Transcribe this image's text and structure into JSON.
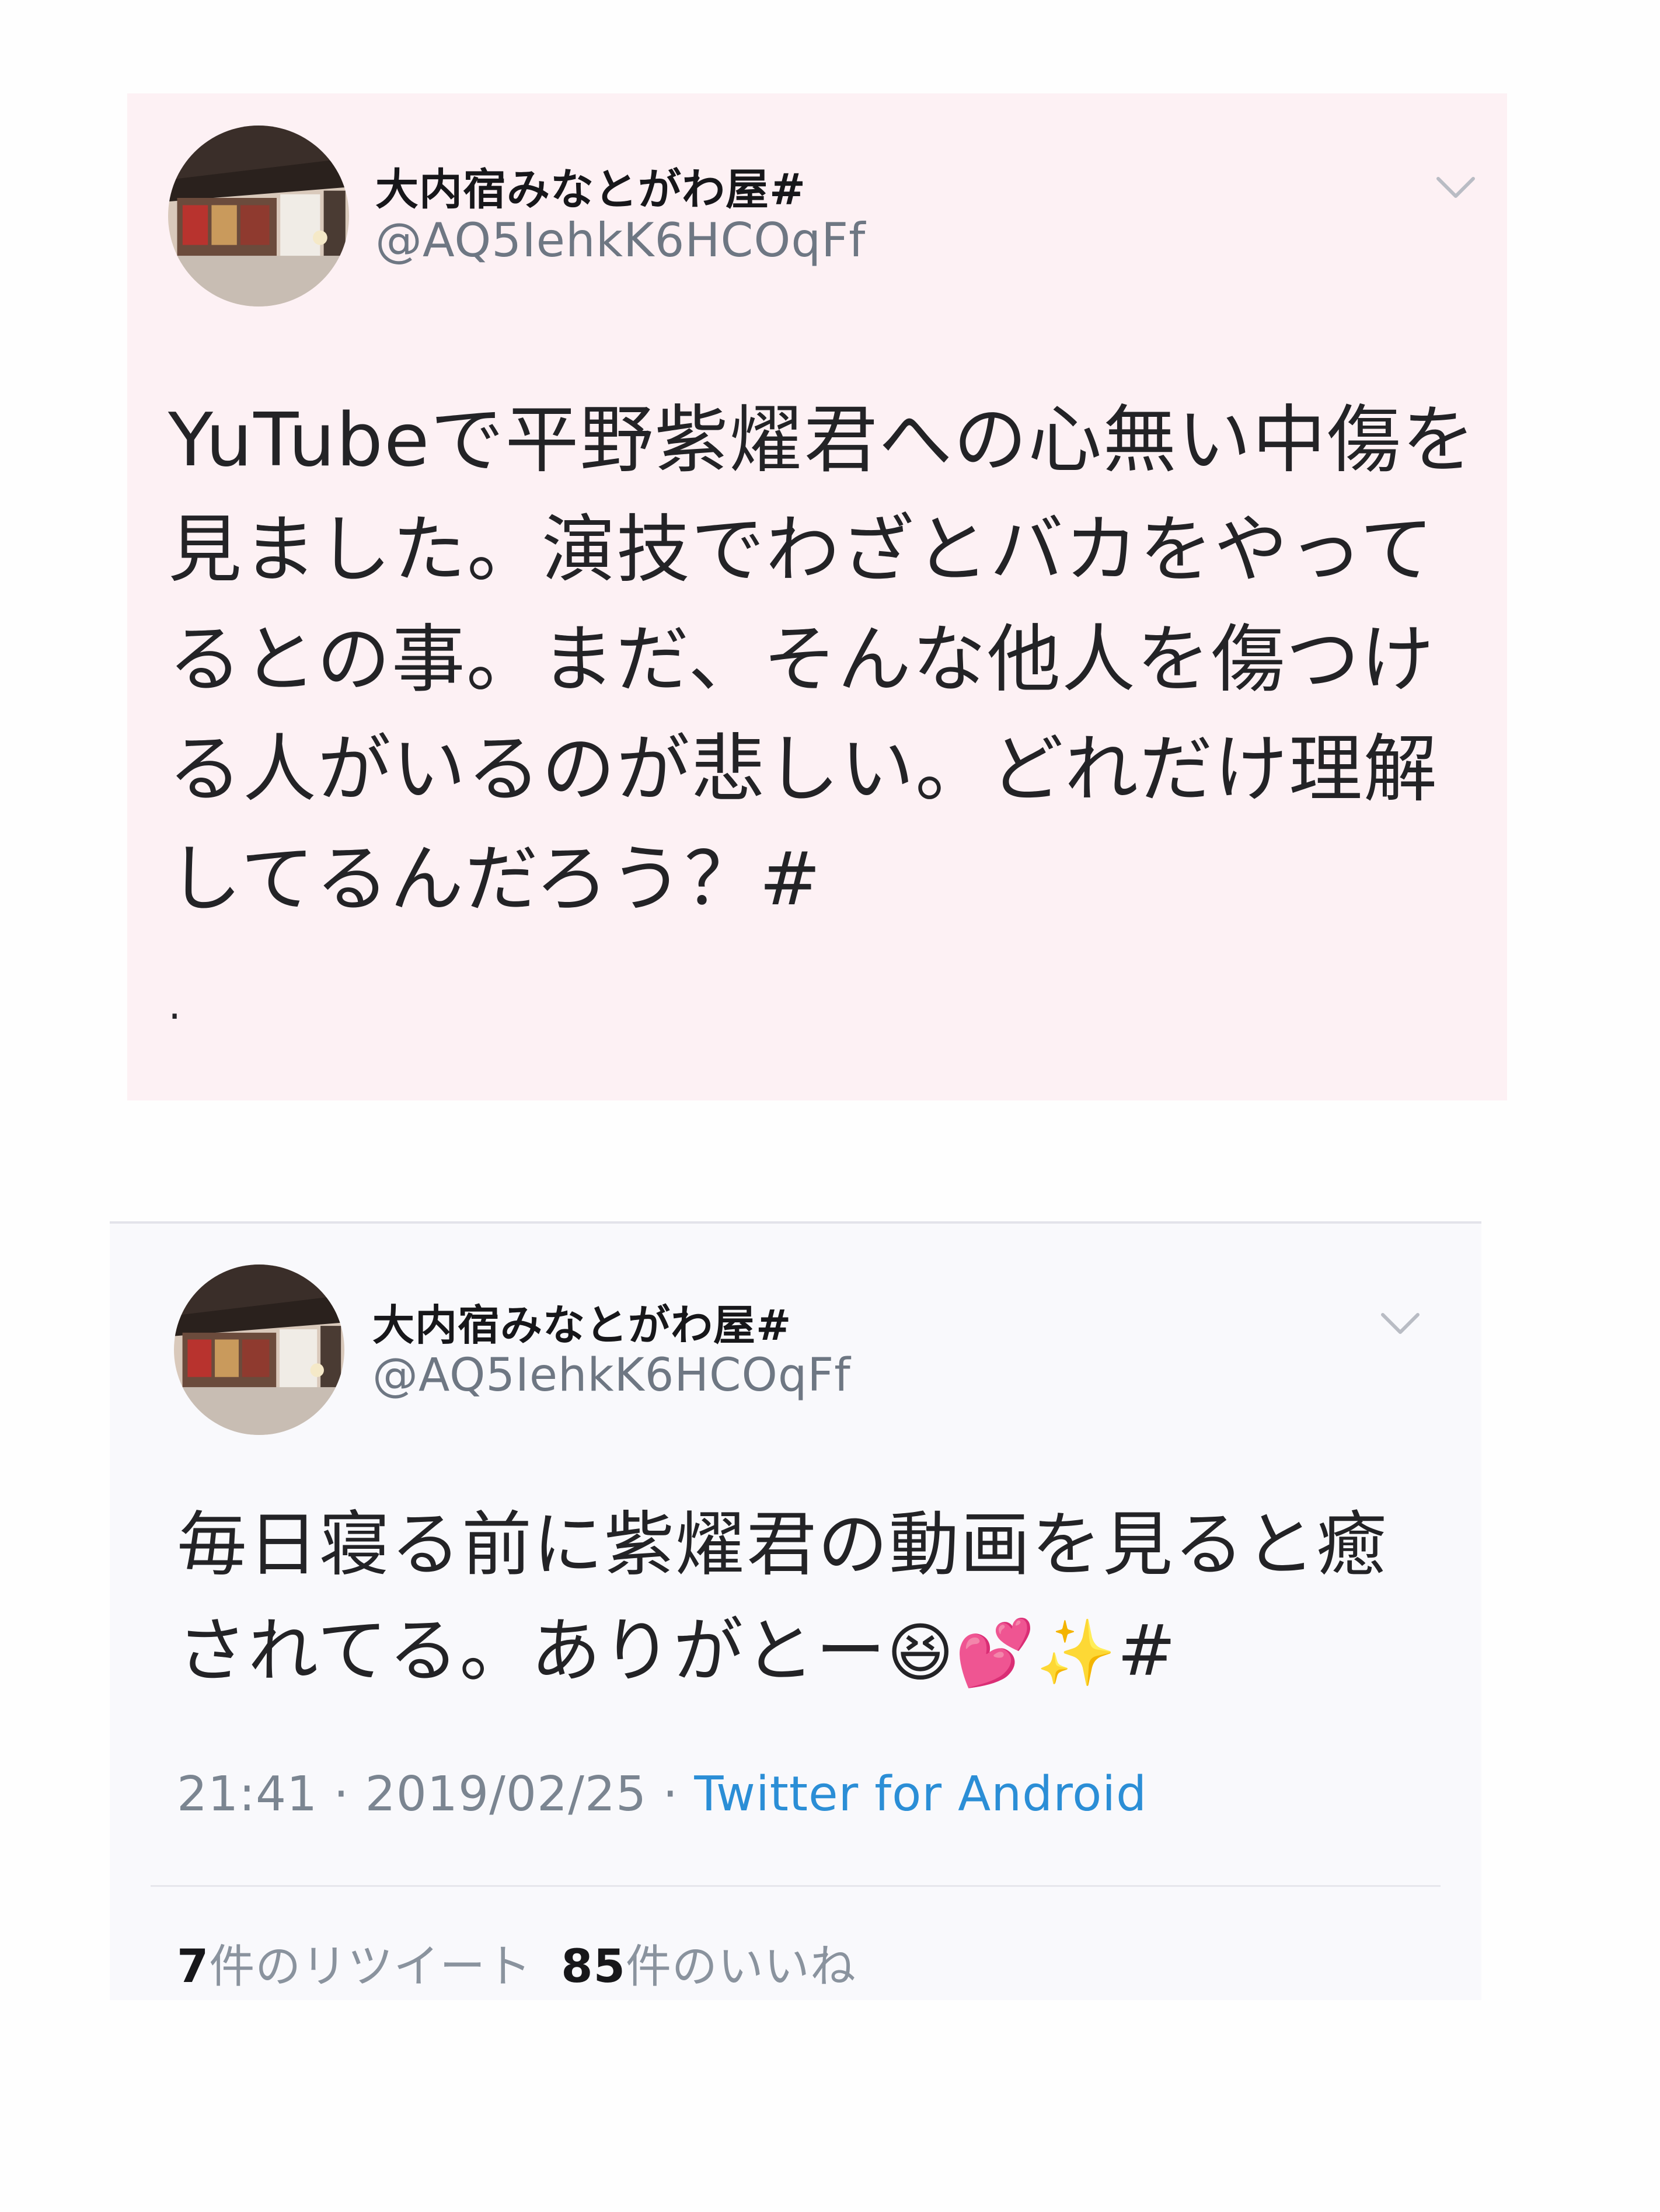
{
  "tweets": [
    {
      "author_name": "大内宿みなとがわ屋#",
      "handle": "@AQ5IehkK6HCOqFf",
      "text_lines": [
        "YuTubeで平野紫燿君への心無い中傷を",
        "見ました。演技でわざとバカをやって",
        "るとの事。まだ、そんな他人を傷つけ",
        "る人がいるのが悲しい。どれだけ理解",
        "してるんだろう？#"
      ],
      "trailing": ".",
      "menu_icon": "chevron-down-icon"
    },
    {
      "author_name": "大内宿みなとがわ屋#",
      "handle": "@AQ5IehkK6HCOqFf",
      "text_lines": [
        "毎日寝る前に紫燿君の動画を見ると癒",
        "されてる。ありがとー"
      ],
      "emoji": "😆💕✨",
      "hashtag": "#",
      "time": "21:41",
      "date": "2019/02/25",
      "separator": "·",
      "source": "Twitter for Android",
      "retweet_count": "7",
      "retweet_label": "件のリツイート",
      "like_count": "85",
      "like_label": "件のいいね",
      "menu_icon": "chevron-down-icon"
    }
  ],
  "colors": {
    "card1_bg": "#fdf1f4",
    "card2_bg": "#f9f9fc",
    "link": "#2b8ed6",
    "muted": "#7b8591"
  }
}
